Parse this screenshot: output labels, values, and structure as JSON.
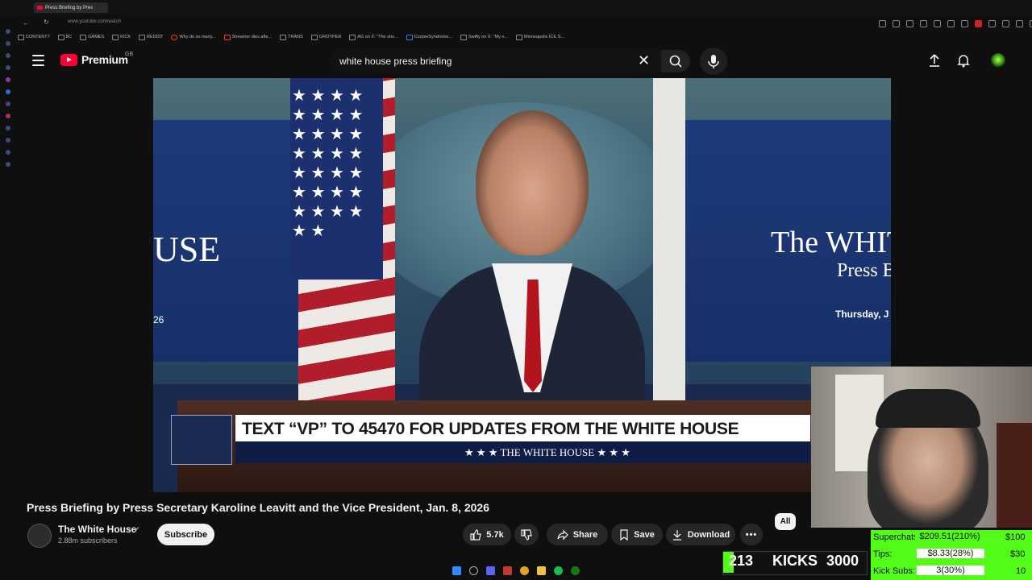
{
  "browser": {
    "tab_title": "Press Briefing by Pres",
    "url": "www.youtube.com/watch",
    "bookmarks": [
      "CONTENT?",
      "BC",
      "GAMES",
      "KICK",
      "REDDIT",
      "Why do so many...",
      "Streamer dies afte...",
      "TRANS",
      "GROYPER",
      "AG on X: \"The sho...",
      "CorpseSyndrome...",
      "Swifty on X: \"My n...",
      "Minneapolis ICE S..."
    ]
  },
  "youtube": {
    "logo_word": "Premium",
    "logo_region": "GB",
    "search_query": "white house press briefing"
  },
  "video": {
    "on_screen_left": "USE",
    "on_screen_left_date": "26",
    "on_screen_right_title": "The WHIT",
    "on_screen_right_sub": "Press B",
    "on_screen_right_date": "Thursday, J",
    "banner_text": "TEXT “VP” TO 45470 FOR UPDATES FROM THE WHITE HOUSE",
    "banner_sub": "★ ★ ★  THE WHITE HOUSE  ★ ★ ★",
    "title": "Press Briefing by Press Secretary Karoline Leavitt and the Vice President, Jan. 8, 2026"
  },
  "channel": {
    "name": "The White House",
    "subscribers": "2.88m subscribers",
    "subscribe_label": "Subscribe"
  },
  "actions": {
    "like_count": "5.7k",
    "share": "Share",
    "save": "Save",
    "download": "Download",
    "chip_all": "All"
  },
  "overlay": {
    "kicks_count": "213",
    "kicks_label": "KICKS",
    "kicks_goal": "3000",
    "kicks_progress": 0.071,
    "superchats_label": "Superchats:",
    "superchats_value": "$209.51(210%)",
    "superchats_goal": "$100",
    "tips_label": "Tips:",
    "tips_value": "$8.33(28%)",
    "tips_goal": "$30",
    "kicksubs_label": "Kick Subs:",
    "kicksubs_value": "3(30%)",
    "kicksubs_goal": "10"
  },
  "colors": {
    "yt_red": "#ff0033",
    "kick_green": "#53fc18",
    "background": "#0f0f0f"
  }
}
